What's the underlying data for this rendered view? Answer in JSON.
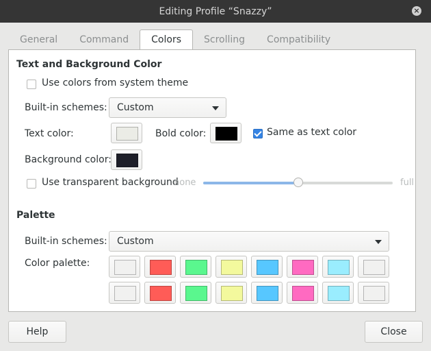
{
  "window": {
    "title": "Editing Profile “Snazzy”"
  },
  "tabs": [
    {
      "label": "General",
      "active": false
    },
    {
      "label": "Command",
      "active": false
    },
    {
      "label": "Colors",
      "active": true
    },
    {
      "label": "Scrolling",
      "active": false
    },
    {
      "label": "Compatibility",
      "active": false
    }
  ],
  "text_bg": {
    "section_title": "Text and Background Color",
    "use_system_colors": {
      "label": "Use colors from system theme",
      "checked": false
    },
    "builtin_label": "Built-in schemes:",
    "builtin_value": "Custom",
    "text_color_label": "Text color:",
    "text_color": "#ebece6",
    "bold_color_label": "Bold color:",
    "bold_color": "#000000",
    "same_as_text": {
      "label": "Same as text color",
      "checked": true
    },
    "bg_color_label": "Background color:",
    "bg_color": "#1e1f29",
    "transparent": {
      "label": "Use transparent background",
      "checked": false
    },
    "slider_min_label": "none",
    "slider_max_label": "full",
    "transparency_level": 0.5
  },
  "palette": {
    "section_title": "Palette",
    "builtin_label": "Built-in schemes:",
    "builtin_value": "Custom",
    "palette_label": "Color palette:",
    "colors": [
      "#f1f1f0",
      "#ff5c57",
      "#5af78e",
      "#f3f99d",
      "#57c7ff",
      "#ff6ac1",
      "#9aedfe",
      "#f1f1f0",
      "#f1f1f0",
      "#ff5c57",
      "#5af78e",
      "#f3f99d",
      "#57c7ff",
      "#ff6ac1",
      "#9aedfe",
      "#f1f1f0"
    ]
  },
  "buttons": {
    "help": "Help",
    "close": "Close"
  }
}
